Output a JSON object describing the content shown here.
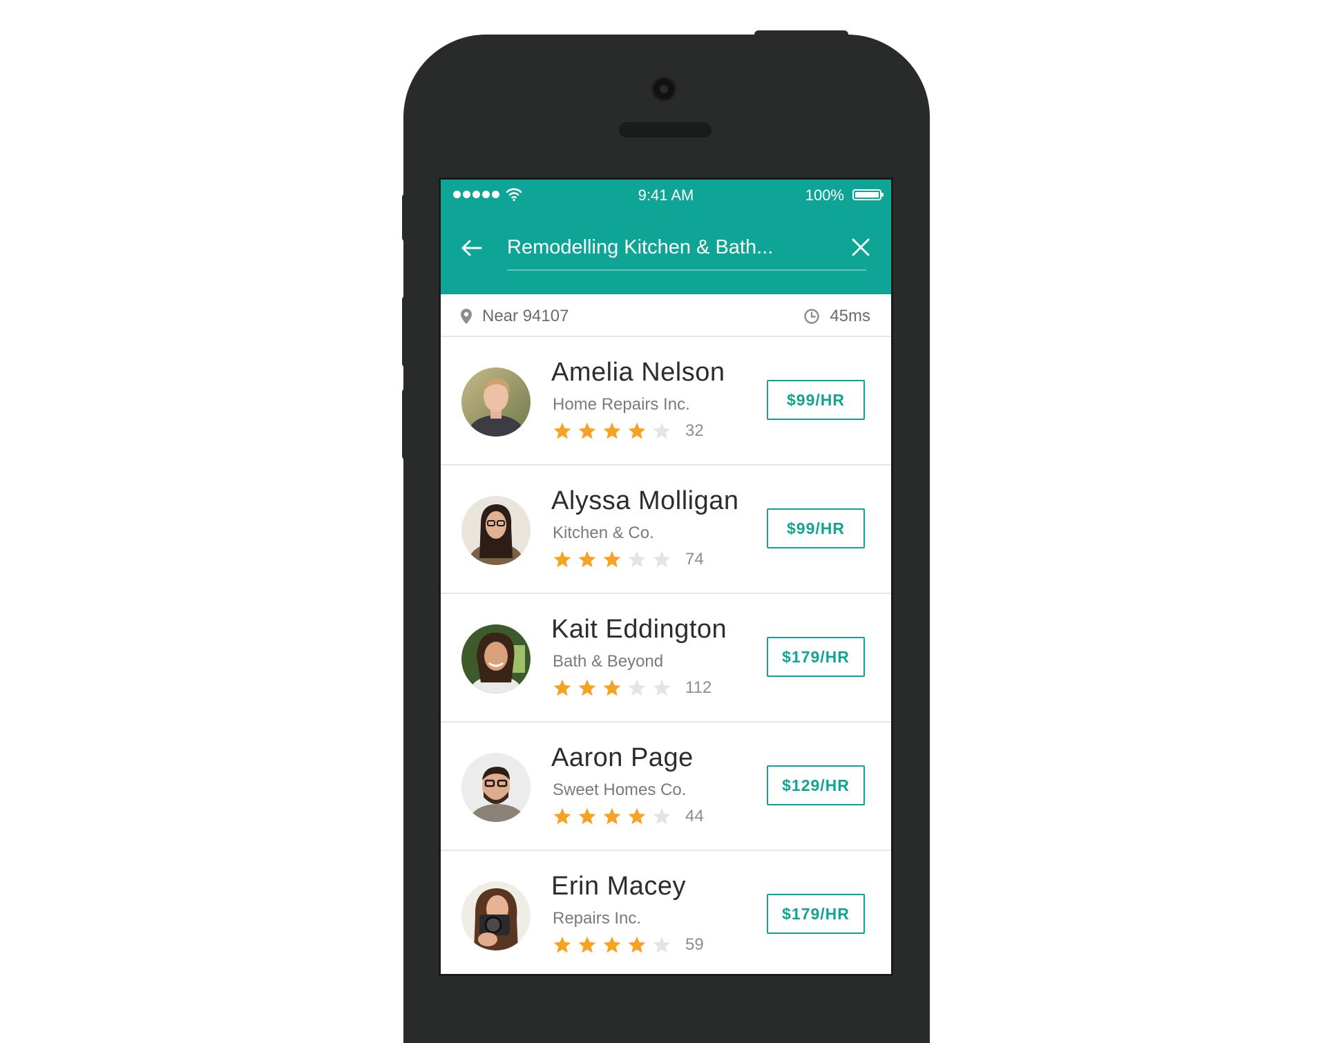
{
  "status_bar": {
    "time": "9:41 AM",
    "battery": "100%"
  },
  "header": {
    "search_value": "Remodelling Kitchen & Bath...",
    "accent_color": "#0fa596"
  },
  "filters": {
    "location": "Near 94107",
    "time": "45ms"
  },
  "icons": {
    "back": "arrow-left-icon",
    "close": "close-icon",
    "location": "map-pin-icon",
    "clock": "clock-icon",
    "star": "star-icon",
    "signal": "signal-dots-icon",
    "wifi": "wifi-icon",
    "battery": "battery-icon"
  },
  "pros": [
    {
      "name": "Amelia Nelson",
      "company": "Home Repairs Inc.",
      "rating": 4,
      "reviews": "32",
      "price": "$99/HR"
    },
    {
      "name": "Alyssa Molligan",
      "company": "Kitchen & Co.",
      "rating": 3,
      "reviews": "74",
      "price": "$99/HR"
    },
    {
      "name": "Kait Eddington",
      "company": "Bath & Beyond",
      "rating": 3,
      "reviews": "112",
      "price": "$179/HR"
    },
    {
      "name": "Aaron Page",
      "company": "Sweet Homes Co.",
      "rating": 4,
      "reviews": "44",
      "price": "$129/HR"
    },
    {
      "name": "Erin Macey",
      "company": "Repairs Inc.",
      "rating": 4,
      "reviews": "59",
      "price": "$179/HR"
    }
  ]
}
